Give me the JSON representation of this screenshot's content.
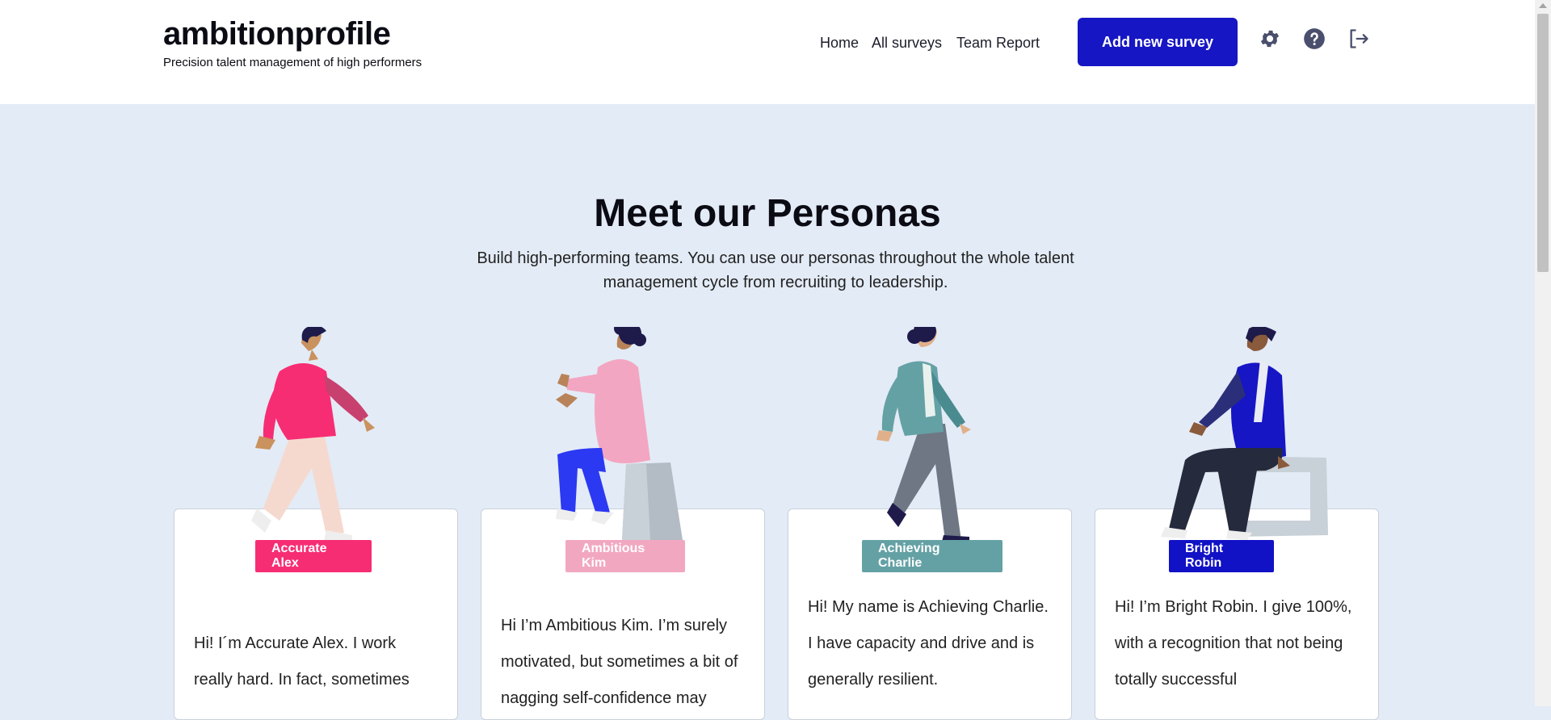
{
  "header": {
    "brand_title": "ambitionprofile",
    "brand_tagline": "Precision talent management of high performers",
    "nav": [
      "Home",
      "All surveys",
      "Team Report"
    ],
    "add_button": "Add new survey",
    "icons": [
      "gear-icon",
      "question-circle-icon",
      "logout-icon"
    ]
  },
  "section": {
    "title": "Meet our Personas",
    "subtitle": "Build high-performing teams. You can use our personas throughout the whole talent management cycle from recruiting to leadership."
  },
  "personas": [
    {
      "name": "Accurate Alex",
      "color": "#f72d73",
      "text": "Hi! I´m Accurate Alex. I work really hard. In fact, sometimes"
    },
    {
      "name": "Ambitious Kim",
      "color": "#f2a7c1",
      "text": "Hi I’m Ambitious Kim. I’m surely motivated, but sometimes a bit of nagging self-confidence may"
    },
    {
      "name": "Achieving Charlie",
      "color": "#64a1a5",
      "text": "Hi! My name is Achieving Charlie. I have capacity and drive and is generally resilient."
    },
    {
      "name": "Bright Robin",
      "color": "#1111c6",
      "text": "Hi! I’m Bright Robin. I give 100%, with a recognition that not being totally successful"
    }
  ],
  "colors": {
    "brand_button": "#1616c4",
    "background": "#e3ebf6"
  }
}
